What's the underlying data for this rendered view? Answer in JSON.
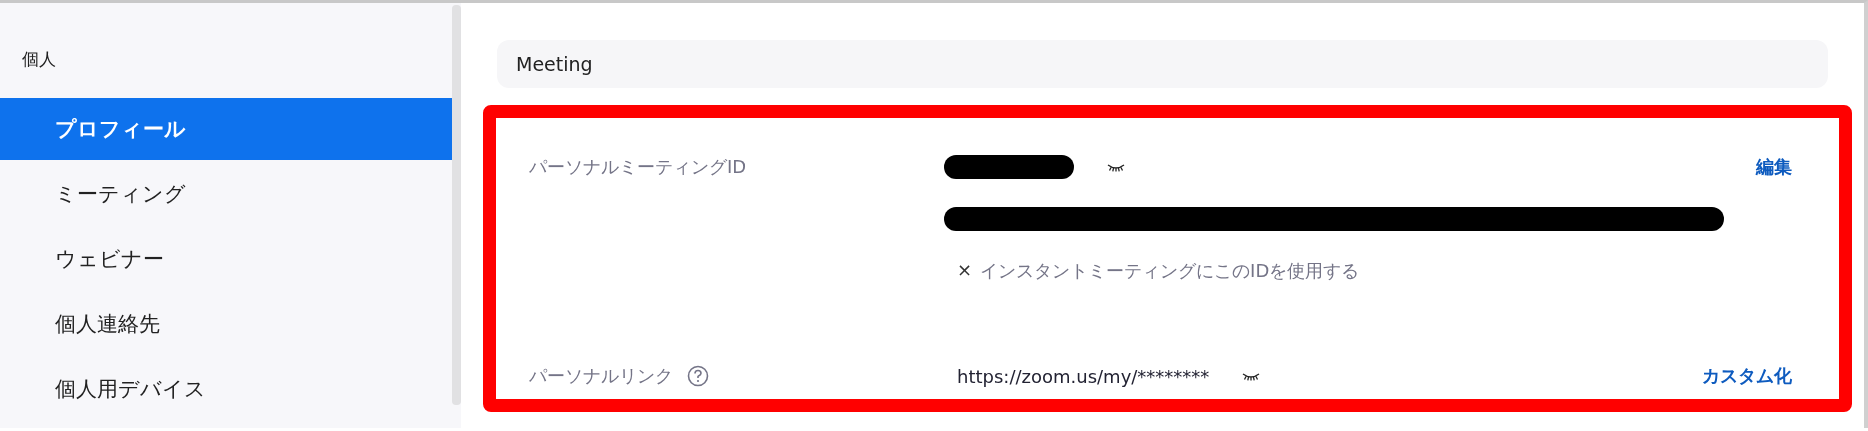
{
  "sidebar": {
    "section": "個人",
    "items": [
      {
        "label": "プロフィール",
        "selected": true
      },
      {
        "label": "ミーティング",
        "selected": false
      },
      {
        "label": "ウェビナー",
        "selected": false
      },
      {
        "label": "個人連絡先",
        "selected": false
      },
      {
        "label": "個人用デバイス",
        "selected": false
      }
    ]
  },
  "section_header": "Meeting",
  "settings": [
    {
      "kind": "id",
      "label": "パーソナルミーティングID",
      "action": "編集",
      "note_mark": "×",
      "note": "インスタントミーティングにこのIDを使用する"
    },
    {
      "kind": "link",
      "label": "パーソナルリンク",
      "help": true,
      "value": "https://zoom.us/my/********",
      "action": "カスタム化"
    }
  ]
}
